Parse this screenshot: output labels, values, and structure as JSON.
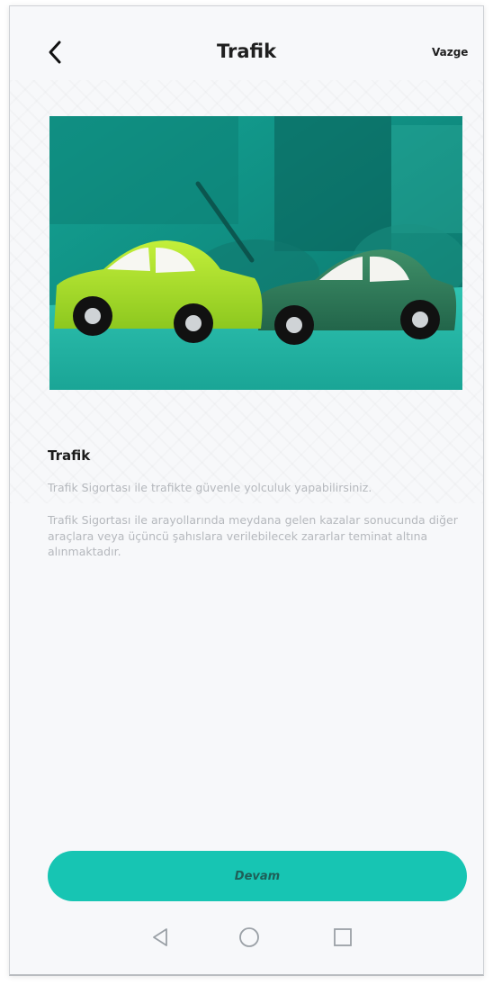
{
  "header": {
    "title": "Trafik",
    "cancel_label": "Vazge"
  },
  "hero": {
    "icon": "car-collision-photo"
  },
  "content": {
    "section_title": "Trafik",
    "paragraph_1": "Trafik Sigortası ile trafikte güvenle yolculuk yapabilirsiniz.",
    "paragraph_2": "Trafik Sigortası ile arayollarında meydana gelen kazalar sonucunda diğer araçlara veya üçüncü şahıslara verilebilecek zararlar teminat altına alınmaktadır."
  },
  "footer": {
    "continue_label": "Devam"
  },
  "colors": {
    "accent": "#17c5b3",
    "button_text": "#1e5f58",
    "body_text": "#b5b8bd"
  }
}
